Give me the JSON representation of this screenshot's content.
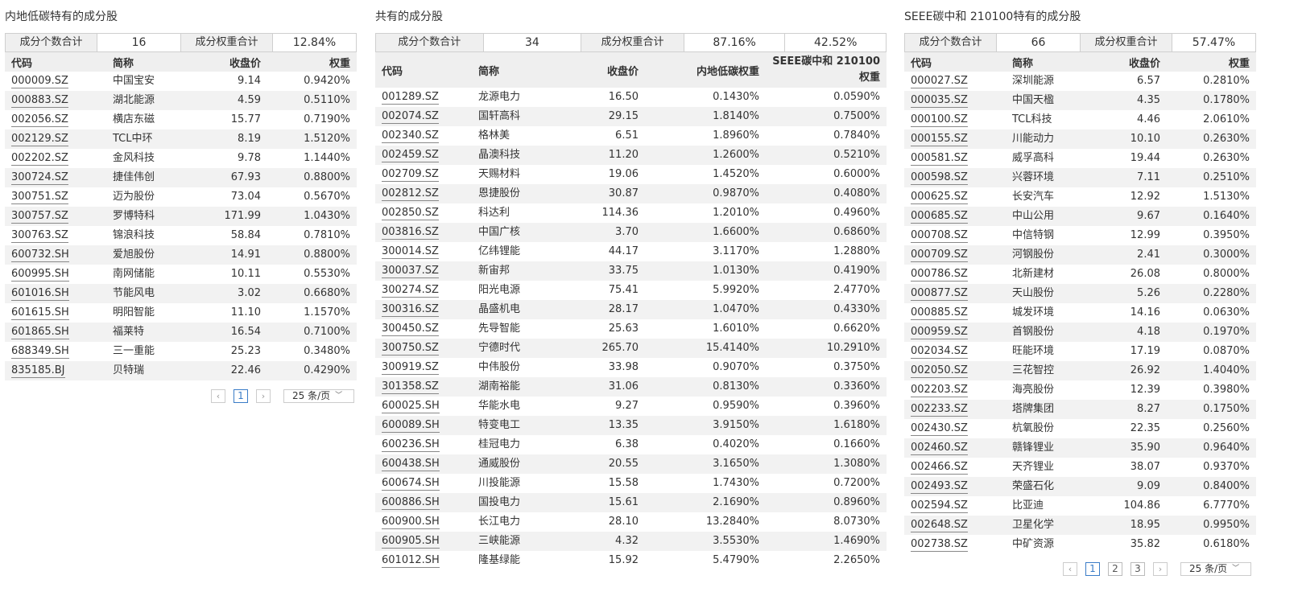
{
  "panels": [
    {
      "title": "内地低碳特有的成分股",
      "summary": [
        {
          "label": "成分个数合计",
          "value": "16"
        },
        {
          "label": "成分权重合计",
          "value": "12.84%"
        }
      ],
      "headers": [
        "代码",
        "简称",
        "收盘价",
        "权重"
      ],
      "rows": [
        [
          "000009.SZ",
          "中国宝安",
          "9.14",
          "0.9420%"
        ],
        [
          "000883.SZ",
          "湖北能源",
          "4.59",
          "0.5110%"
        ],
        [
          "002056.SZ",
          "横店东磁",
          "15.77",
          "0.7190%"
        ],
        [
          "002129.SZ",
          "TCL中环",
          "8.19",
          "1.5120%"
        ],
        [
          "002202.SZ",
          "金风科技",
          "9.78",
          "1.1440%"
        ],
        [
          "300724.SZ",
          "捷佳伟创",
          "67.93",
          "0.8800%"
        ],
        [
          "300751.SZ",
          "迈为股份",
          "73.04",
          "0.5670%"
        ],
        [
          "300757.SZ",
          "罗博特科",
          "171.99",
          "1.0430%"
        ],
        [
          "300763.SZ",
          "锦浪科技",
          "58.84",
          "0.7810%"
        ],
        [
          "600732.SH",
          "爱旭股份",
          "14.91",
          "0.8800%"
        ],
        [
          "600995.SH",
          "南网储能",
          "10.11",
          "0.5530%"
        ],
        [
          "601016.SH",
          "节能风电",
          "3.02",
          "0.6680%"
        ],
        [
          "601615.SH",
          "明阳智能",
          "11.10",
          "1.1570%"
        ],
        [
          "601865.SH",
          "福莱特",
          "16.54",
          "0.7100%"
        ],
        [
          "688349.SH",
          "三一重能",
          "25.23",
          "0.3480%"
        ],
        [
          "835185.BJ",
          "贝特瑞",
          "22.46",
          "0.4290%"
        ]
      ],
      "pager": {
        "prev": "‹",
        "next": "›",
        "pages": [
          "1"
        ],
        "active_page": "1",
        "page_size": "25 条/页"
      }
    },
    {
      "title": "共有的成分股",
      "summary": [
        {
          "label": "成分个数合计",
          "value": "34"
        },
        {
          "label": "成分权重合计",
          "value": "87.16%"
        },
        {
          "label": "",
          "value": "42.52%"
        }
      ],
      "headers": [
        "代码",
        "简称",
        "收盘价",
        "内地低碳权重",
        "SEEE碳中和 210100权重"
      ],
      "rows": [
        [
          "001289.SZ",
          "龙源电力",
          "16.50",
          "0.1430%",
          "0.0590%"
        ],
        [
          "002074.SZ",
          "国轩高科",
          "29.15",
          "1.8140%",
          "0.7500%"
        ],
        [
          "002340.SZ",
          "格林美",
          "6.51",
          "1.8960%",
          "0.7840%"
        ],
        [
          "002459.SZ",
          "晶澳科技",
          "11.20",
          "1.2600%",
          "0.5210%"
        ],
        [
          "002709.SZ",
          "天赐材料",
          "19.06",
          "1.4520%",
          "0.6000%"
        ],
        [
          "002812.SZ",
          "恩捷股份",
          "30.87",
          "0.9870%",
          "0.4080%"
        ],
        [
          "002850.SZ",
          "科达利",
          "114.36",
          "1.2010%",
          "0.4960%"
        ],
        [
          "003816.SZ",
          "中国广核",
          "3.70",
          "1.6600%",
          "0.6860%"
        ],
        [
          "300014.SZ",
          "亿纬锂能",
          "44.17",
          "3.1170%",
          "1.2880%"
        ],
        [
          "300037.SZ",
          "新宙邦",
          "33.75",
          "1.0130%",
          "0.4190%"
        ],
        [
          "300274.SZ",
          "阳光电源",
          "75.41",
          "5.9920%",
          "2.4770%"
        ],
        [
          "300316.SZ",
          "晶盛机电",
          "28.17",
          "1.0470%",
          "0.4330%"
        ],
        [
          "300450.SZ",
          "先导智能",
          "25.63",
          "1.6010%",
          "0.6620%"
        ],
        [
          "300750.SZ",
          "宁德时代",
          "265.70",
          "15.4140%",
          "10.2910%"
        ],
        [
          "300919.SZ",
          "中伟股份",
          "33.98",
          "0.9070%",
          "0.3750%"
        ],
        [
          "301358.SZ",
          "湖南裕能",
          "31.06",
          "0.8130%",
          "0.3360%"
        ],
        [
          "600025.SH",
          "华能水电",
          "9.27",
          "0.9590%",
          "0.3960%"
        ],
        [
          "600089.SH",
          "特变电工",
          "13.35",
          "3.9150%",
          "1.6180%"
        ],
        [
          "600236.SH",
          "桂冠电力",
          "6.38",
          "0.4020%",
          "0.1660%"
        ],
        [
          "600438.SH",
          "通威股份",
          "20.55",
          "3.1650%",
          "1.3080%"
        ],
        [
          "600674.SH",
          "川投能源",
          "15.58",
          "1.7430%",
          "0.7200%"
        ],
        [
          "600886.SH",
          "国投电力",
          "15.61",
          "2.1690%",
          "0.8960%"
        ],
        [
          "600900.SH",
          "长江电力",
          "28.10",
          "13.2840%",
          "8.0730%"
        ],
        [
          "600905.SH",
          "三峡能源",
          "4.32",
          "3.5530%",
          "1.4690%"
        ],
        [
          "601012.SH",
          "隆基绿能",
          "15.92",
          "5.4790%",
          "2.2650%"
        ]
      ]
    },
    {
      "title": "SEEE碳中和 210100特有的成分股",
      "summary": [
        {
          "label": "成分个数合计",
          "value": "66"
        },
        {
          "label": "成分权重合计",
          "value": "57.47%"
        }
      ],
      "headers": [
        "代码",
        "简称",
        "收盘价",
        "权重"
      ],
      "rows": [
        [
          "000027.SZ",
          "深圳能源",
          "6.57",
          "0.2810%"
        ],
        [
          "000035.SZ",
          "中国天楹",
          "4.35",
          "0.1780%"
        ],
        [
          "000100.SZ",
          "TCL科技",
          "4.46",
          "2.0610%"
        ],
        [
          "000155.SZ",
          "川能动力",
          "10.10",
          "0.2630%"
        ],
        [
          "000581.SZ",
          "威孚高科",
          "19.44",
          "0.2630%"
        ],
        [
          "000598.SZ",
          "兴蓉环境",
          "7.11",
          "0.2510%"
        ],
        [
          "000625.SZ",
          "长安汽车",
          "12.92",
          "1.5130%"
        ],
        [
          "000685.SZ",
          "中山公用",
          "9.67",
          "0.1640%"
        ],
        [
          "000708.SZ",
          "中信特钢",
          "12.99",
          "0.3950%"
        ],
        [
          "000709.SZ",
          "河钢股份",
          "2.41",
          "0.3000%"
        ],
        [
          "000786.SZ",
          "北新建材",
          "26.08",
          "0.8000%"
        ],
        [
          "000877.SZ",
          "天山股份",
          "5.26",
          "0.2280%"
        ],
        [
          "000885.SZ",
          "城发环境",
          "14.16",
          "0.0630%"
        ],
        [
          "000959.SZ",
          "首钢股份",
          "4.18",
          "0.1970%"
        ],
        [
          "002034.SZ",
          "旺能环境",
          "17.19",
          "0.0870%"
        ],
        [
          "002050.SZ",
          "三花智控",
          "26.92",
          "1.4040%"
        ],
        [
          "002203.SZ",
          "海亮股份",
          "12.39",
          "0.3980%"
        ],
        [
          "002233.SZ",
          "塔牌集团",
          "8.27",
          "0.1750%"
        ],
        [
          "002430.SZ",
          "杭氧股份",
          "22.35",
          "0.2560%"
        ],
        [
          "002460.SZ",
          "赣锋锂业",
          "35.90",
          "0.9640%"
        ],
        [
          "002466.SZ",
          "天齐锂业",
          "38.07",
          "0.9370%"
        ],
        [
          "002493.SZ",
          "荣盛石化",
          "9.09",
          "0.8400%"
        ],
        [
          "002594.SZ",
          "比亚迪",
          "104.86",
          "6.7770%"
        ],
        [
          "002648.SZ",
          "卫星化学",
          "18.95",
          "0.9950%"
        ],
        [
          "002738.SZ",
          "中矿资源",
          "35.82",
          "0.6180%"
        ]
      ],
      "pager": {
        "prev": "‹",
        "next": "›",
        "pages": [
          "1",
          "2",
          "3"
        ],
        "active_page": "1",
        "page_size": "25 条/页"
      }
    }
  ]
}
